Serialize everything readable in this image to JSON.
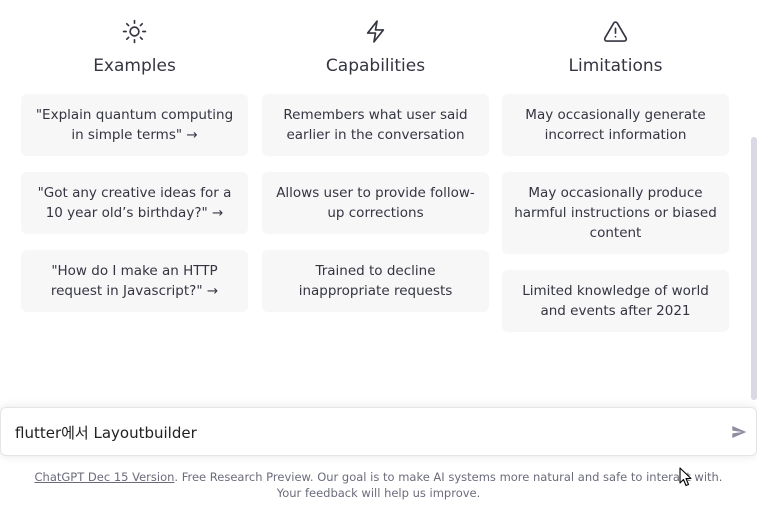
{
  "columns": [
    {
      "icon": "sun-icon",
      "title": "Examples",
      "cards": [
        "\"Explain quantum computing in simple terms\" →",
        "\"Got any creative ideas for a 10 year old’s birthday?\" →",
        "\"How do I make an HTTP request in Javascript?\" →"
      ]
    },
    {
      "icon": "lightning-icon",
      "title": "Capabilities",
      "cards": [
        "Remembers what user said earlier in the conversation",
        "Allows user to provide follow-up corrections",
        "Trained to decline inappropriate requests"
      ]
    },
    {
      "icon": "warning-icon",
      "title": "Limitations",
      "cards": [
        "May occasionally generate incorrect information",
        "May occasionally produce harmful instructions or biased content",
        "Limited knowledge of world and events after 2021"
      ]
    }
  ],
  "input": {
    "value": "flutter에서 Layoutbuilder"
  },
  "footer": {
    "link_text": "ChatGPT Dec 15 Version",
    "text": ". Free Research Preview. Our goal is to make AI systems more natural and safe to interact with. Your feedback will help us improve."
  },
  "colors": {
    "card_bg": "#f7f7f8",
    "text": "#343541",
    "muted": "#6b6c7b"
  }
}
